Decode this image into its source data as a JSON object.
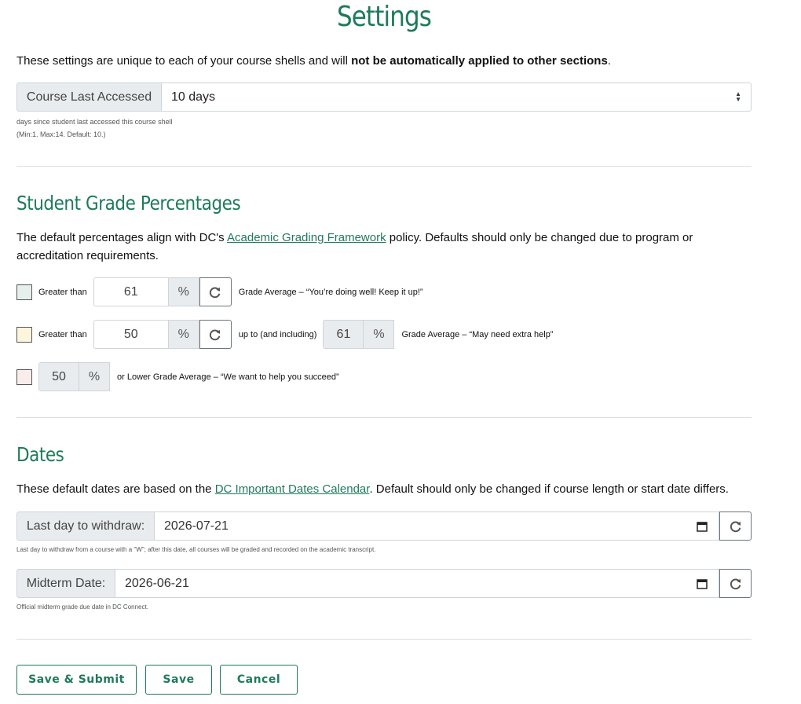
{
  "page": {
    "title": "Settings",
    "intro_text": "These settings are unique to each of your course shells and will ",
    "intro_bold": "not be automatically applied to other sections",
    "intro_end": "."
  },
  "last_accessed": {
    "label": "Course Last Accessed",
    "value": "10 days",
    "help_line1": "days since student last accessed this course shell",
    "help_line2": "(Min:1. Max:14. Default: 10.)"
  },
  "grades": {
    "title": "Student Grade Percentages",
    "desc_before": "The default percentages align with DC's ",
    "desc_link": "Academic Grading Framework",
    "desc_after": " policy. Defaults should only be changed due to program or accreditation requirements.",
    "rows": [
      {
        "label": "Greater than",
        "value": "61",
        "unit": "%",
        "description": "Grade Average – “You’re doing well! Keep it up!”",
        "swatch": "#e6efec"
      },
      {
        "label": "Greater than",
        "value": "50",
        "unit": "%",
        "mid_label": "up to (and including)",
        "upper": "61",
        "upper_unit": "%",
        "description": "Grade Average – “May need extra help”",
        "swatch": "#fdf6dd"
      },
      {
        "value": "50",
        "unit": "%",
        "description": "or Lower Grade Average – “We want to help you succeed”",
        "swatch": "#f9ecea"
      }
    ]
  },
  "dates": {
    "title": "Dates",
    "desc_before": "These default dates are based on the ",
    "desc_link": "DC Important Dates Calendar",
    "desc_after": ". Default should only be changed if course length or start date differs.",
    "withdraw": {
      "label": "Last day to withdraw:",
      "value": "2026-07-21",
      "help": "Last day to withdraw from a course with a \"W\"; after this date, all courses will be graded and recorded on the academic transcript."
    },
    "midterm": {
      "label": "Midterm Date:",
      "value": "2026-06-21",
      "help": "Official midterm grade due date in DC Connect."
    }
  },
  "actions": {
    "save_submit": "Save & Submit",
    "save": "Save",
    "cancel": "Cancel"
  },
  "colors": {
    "accent": "#1f7a5c"
  }
}
